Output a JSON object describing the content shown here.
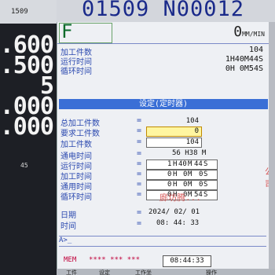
{
  "left": {
    "top_label": "1509",
    "numbers": [
      ".600",
      ".500",
      "5",
      ".000",
      ".000"
    ],
    "small_value": "45"
  },
  "header": {
    "title": "01509 N00012"
  },
  "screen": {
    "mode": "F",
    "speed": "0",
    "speed_unit": "MM/MIN",
    "top_rows": [
      {
        "label": "加工件数",
        "value": "104"
      },
      {
        "label": "运行时间",
        "value": "1H40M44S"
      },
      {
        "label": "循环时间",
        "value": "0H 0M54S"
      }
    ],
    "section_title": "设定(定时器)",
    "settings": [
      {
        "label": "总加工件数",
        "value": "104"
      },
      {
        "label": "要求工件数",
        "value": "0"
      },
      {
        "label": "加工件数",
        "value": "104"
      }
    ],
    "power_on": {
      "label": "通电时间",
      "value": "56 H38 M"
    },
    "timers": [
      {
        "label": "运行时间",
        "h": "1",
        "m": "40",
        "s": "44"
      },
      {
        "label": "加工时间",
        "h": "0",
        "m": "0",
        "s": "0"
      },
      {
        "label": "通用时间",
        "h": "0",
        "m": "0",
        "s": "0"
      },
      {
        "label": "循环时间",
        "h": "0",
        "m": "0",
        "s": "54"
      }
    ],
    "date": {
      "label": "日期",
      "y": "2024",
      "mo": "02",
      "d": "01"
    },
    "time": {
      "label": "时间",
      "h": "08",
      "m": "44",
      "s": "33"
    },
    "input_prompt": "A>_",
    "status": {
      "mode": "MEM",
      "stars": "**** *** ***",
      "time": "08:44:33"
    }
  },
  "softkeys": [
    "工件",
    "设定",
    "工作坐",
    "操作"
  ],
  "watermarks": [
    "公司",
    "廊坊腾..."
  ]
}
